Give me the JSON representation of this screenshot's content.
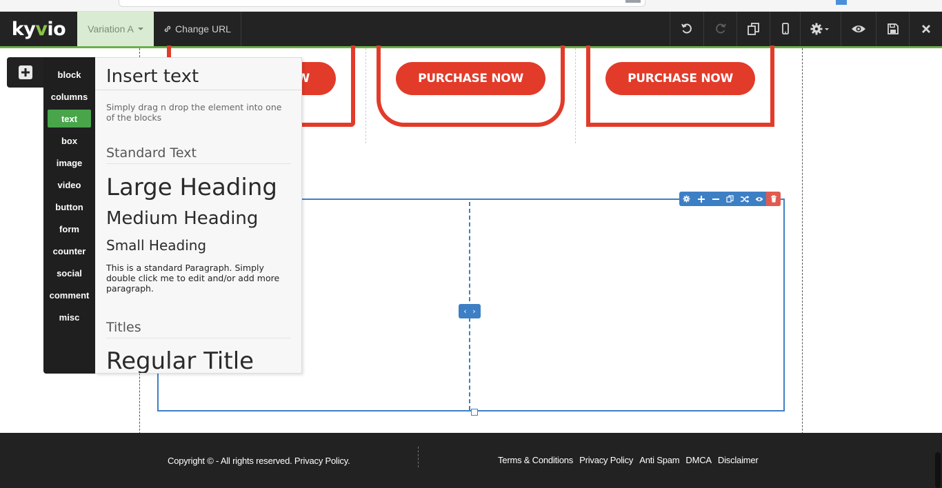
{
  "toolbar": {
    "logo": {
      "part1": "ky",
      "part2": "v",
      "part3": "io"
    },
    "variation_label": "Variation A",
    "change_url_label": "Change URL"
  },
  "pricing": {
    "buttons": [
      "PURCHASE NOW",
      "PURCHASE NOW"
    ],
    "partial_button": "W"
  },
  "add_panel": {
    "categories": [
      "block",
      "columns",
      "text",
      "box",
      "image",
      "video",
      "button",
      "form",
      "counter",
      "social",
      "comment",
      "misc"
    ],
    "active_category": "text",
    "insert": {
      "title": "Insert text",
      "description": "Simply drag n drop the element into one of the blocks",
      "section_standard": "Standard Text",
      "large_heading": "Large Heading",
      "medium_heading": "Medium Heading",
      "small_heading": "Small Heading",
      "paragraph": "This is a standard Paragraph. Simply double click me to edit and/or add more paragraph.",
      "section_titles": "Titles",
      "regular_title": "Regular Title"
    }
  },
  "row_toolbar": {
    "icons": [
      "gear-icon",
      "plus-icon",
      "minus-icon",
      "copy-icon",
      "shuffle-icon",
      "eye-icon",
      "trash-icon"
    ],
    "resize_arrows": {
      "left": "‹",
      "right": "›"
    }
  },
  "footer": {
    "copyright": "Copyright © - All rights reserved. Privacy Policy.",
    "links": [
      "Terms & Conditions",
      "Privacy Policy",
      "Anti Spam",
      "DMCA",
      "Disclaimer"
    ]
  },
  "colors": {
    "toolbar_bg": "#232323",
    "accent_green": "#6ab04c",
    "brand_red": "#e23b2a",
    "selection_blue": "#3d7fc4",
    "footer_bg": "#222222"
  }
}
